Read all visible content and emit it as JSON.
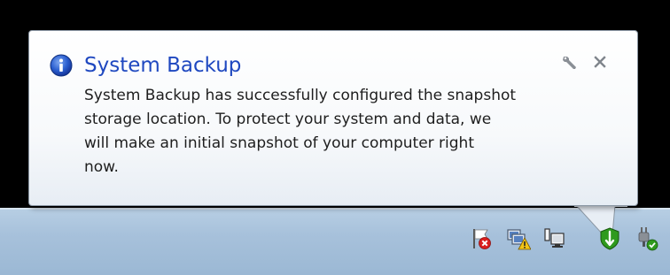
{
  "balloon": {
    "title": "System Backup",
    "body_lines": [
      "System Backup has successfully configured the snapshot",
      "storage location. To protect your system and data, we",
      "will make an initial snapshot of your computer right",
      "now."
    ],
    "options_icon": "wrench-icon",
    "close_icon": "close-icon",
    "info_icon": "info-icon"
  },
  "tray": {
    "icons": [
      "action-center-flag-error-icon",
      "network-warning-icon",
      "network-display-icon",
      "system-backup-shield-icon",
      "power-plug-check-icon"
    ]
  },
  "colors": {
    "title": "#1f48c0",
    "body_text": "#1e1e1e",
    "taskbar": "#a7c1db",
    "desktop": "#000000",
    "shield_green": "#2f9a1e"
  }
}
